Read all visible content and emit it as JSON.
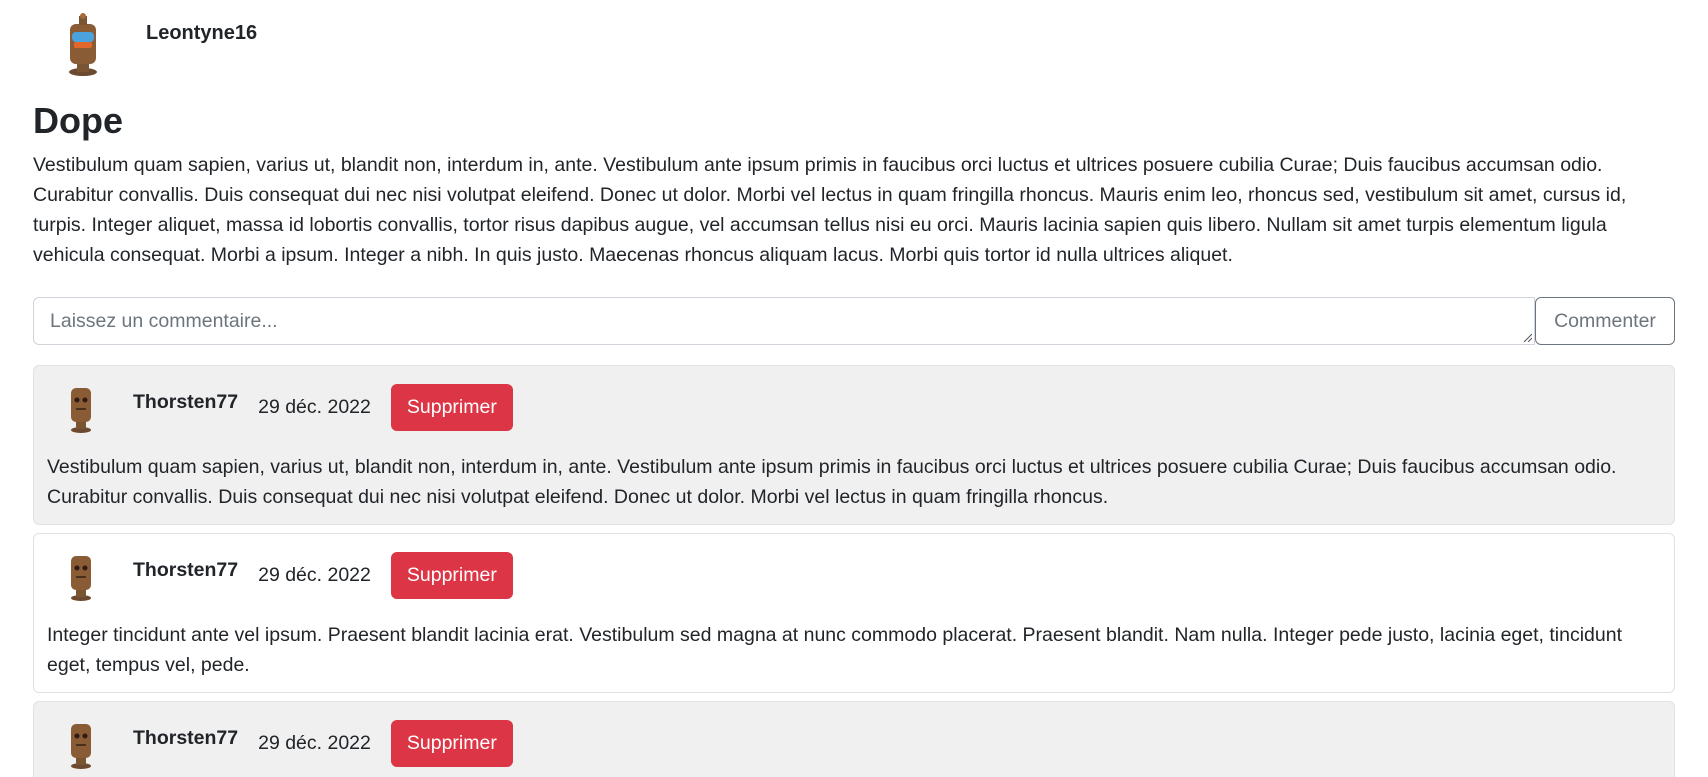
{
  "post": {
    "author": "Leontyne16",
    "author_avatar_icon": "robot-avatar-icon",
    "title": "Dope",
    "body": "Vestibulum quam sapien, varius ut, blandit non, interdum in, ante. Vestibulum ante ipsum primis in faucibus orci luctus et ultrices posuere cubilia Curae; Duis faucibus accumsan odio. Curabitur convallis. Duis consequat dui nec nisi volutpat eleifend. Donec ut dolor. Morbi vel lectus in quam fringilla rhoncus. Mauris enim leo, rhoncus sed, vestibulum sit amet, cursus id, turpis. Integer aliquet, massa id lobortis convallis, tortor risus dapibus augue, vel accumsan tellus nisi eu orci. Mauris lacinia sapien quis libero. Nullam sit amet turpis elementum ligula vehicula consequat. Morbi a ipsum. Integer a nibh. In quis justo. Maecenas rhoncus aliquam lacus. Morbi quis tortor id nulla ultrices aliquet."
  },
  "comment_form": {
    "placeholder": "Laissez un commentaire...",
    "submit_label": "Commenter"
  },
  "comments": [
    {
      "user": "Thorsten77",
      "date": "29 déc. 2022",
      "delete_label": "Supprimer",
      "text": "Vestibulum quam sapien, varius ut, blandit non, interdum in, ante. Vestibulum ante ipsum primis in faucibus orci luctus et ultrices posuere cubilia Curae; Duis faucibus accumsan odio. Curabitur convallis. Duis consequat dui nec nisi volutpat eleifend. Donec ut dolor. Morbi vel lectus in quam fringilla rhoncus."
    },
    {
      "user": "Thorsten77",
      "date": "29 déc. 2022",
      "delete_label": "Supprimer",
      "text": "Integer tincidunt ante vel ipsum. Praesent blandit lacinia erat. Vestibulum sed magna at nunc commodo placerat. Praesent blandit. Nam nulla. Integer pede justo, lacinia eget, tincidunt eget, tempus vel, pede."
    },
    {
      "user": "Thorsten77",
      "date": "29 déc. 2022",
      "delete_label": "Supprimer",
      "text": ""
    }
  ],
  "colors": {
    "danger": "#dc3545",
    "alt_row": "#f0f0f0",
    "secondary": "#6c757d"
  }
}
